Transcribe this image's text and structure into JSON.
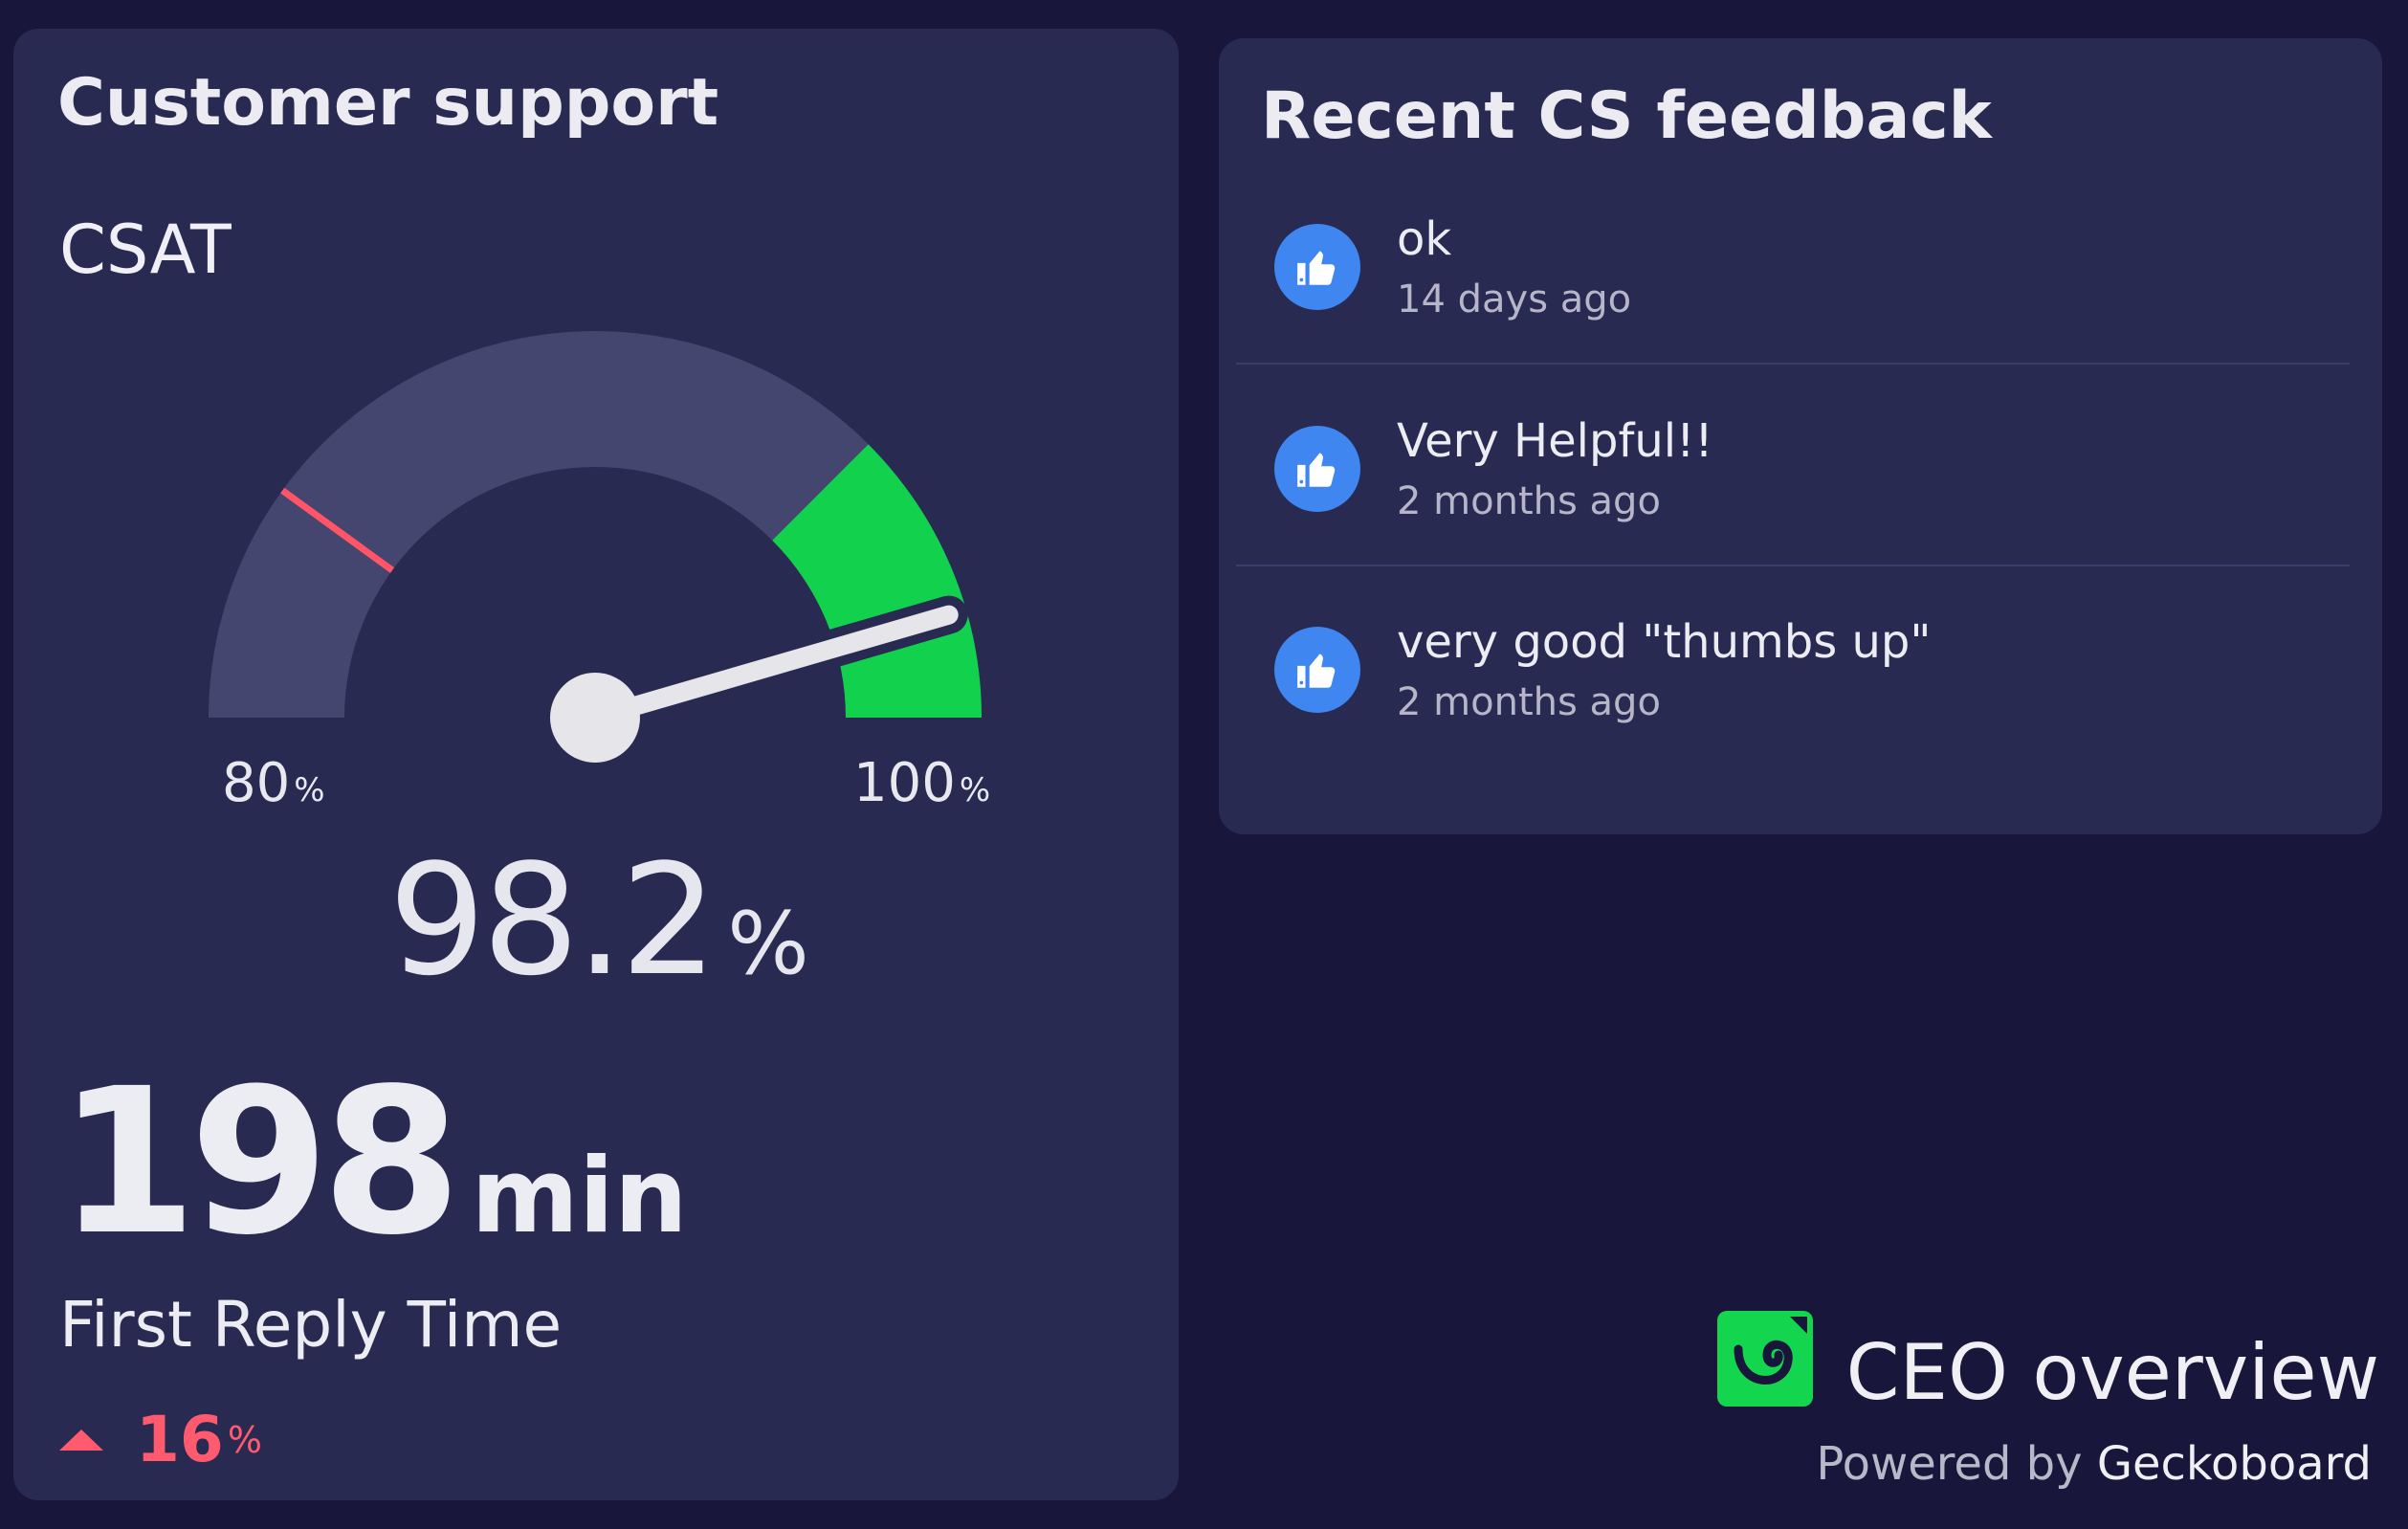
{
  "customer_support": {
    "title": "Customer support",
    "csat": {
      "label": "CSAT",
      "value": "98.2",
      "unit": "%",
      "gauge": {
        "min_label": "80",
        "max_label": "100",
        "unit": "%",
        "min": 80,
        "max": 100,
        "value": 98.2,
        "red_threshold": 84,
        "green_threshold": 95,
        "colors": {
          "track": "#45466f",
          "green": "#12d14d",
          "red": "#ff5566",
          "needle": "#e5e5ea"
        }
      }
    },
    "first_reply_time": {
      "value": "198",
      "unit": "min",
      "label": "First Reply Time",
      "change": "16",
      "change_unit": "%",
      "change_direction": "up",
      "change_color": "#ff5a6e"
    }
  },
  "feedback": {
    "title": "Recent CS feedback",
    "items": [
      {
        "text": "ok",
        "time": "14 days ago",
        "icon": "thumbs-up-icon"
      },
      {
        "text": "Very Helpful!!",
        "time": "2 months ago",
        "icon": "thumbs-up-icon"
      },
      {
        "text": "very good \"thumbs up\"",
        "time": "2 months ago",
        "icon": "thumbs-up-icon"
      }
    ]
  },
  "brand": {
    "dashboard_name": "CEO overview",
    "powered_prefix": "Powered by",
    "powered_name": "Geckoboard",
    "logo": "geckoboard-logo"
  },
  "colors": {
    "background": "#18163a",
    "panel": "#282a52",
    "accent_blue": "#3f86f0",
    "accent_green": "#14d64e"
  }
}
